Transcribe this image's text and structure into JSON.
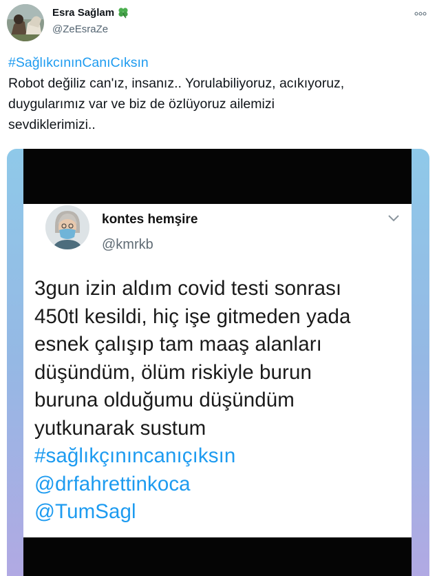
{
  "author": {
    "display_name": "Esra Sağlam",
    "emoji_icon": "four-leaf-clover-icon",
    "handle": "@ZeEsraZe"
  },
  "tweet": {
    "hashtag": "#SağlıkcınınCanıCıksın",
    "lines": [
      "Robot değiliz can'ız, insanız.. Yorulabiliyoruz, acıkıyoruz,",
      "duygularımız var ve biz de özlüyoruz ailemizi",
      "sevdiklerimizi.."
    ]
  },
  "embedded_screenshot": {
    "name": "kontes hemşire",
    "handle": "@kmrkb",
    "text_lines": [
      "3gun izin aldım covid testi sonrası",
      "450tl kesildi, hiç işe gitmeden yada",
      "esnek çalışıp tam maaş alanları",
      "düşündüm,  ölüm riskiyle burun",
      "buruna olduğumu düşündüm",
      "yutkunarak sustum"
    ],
    "links": [
      "#sağlıkçınıncanıçıksın",
      "@drfahrettinkoca",
      "@TumSagl"
    ]
  },
  "colors": {
    "link": "#1d9bf0",
    "text": "#0f1419",
    "secondary": "#536471"
  }
}
